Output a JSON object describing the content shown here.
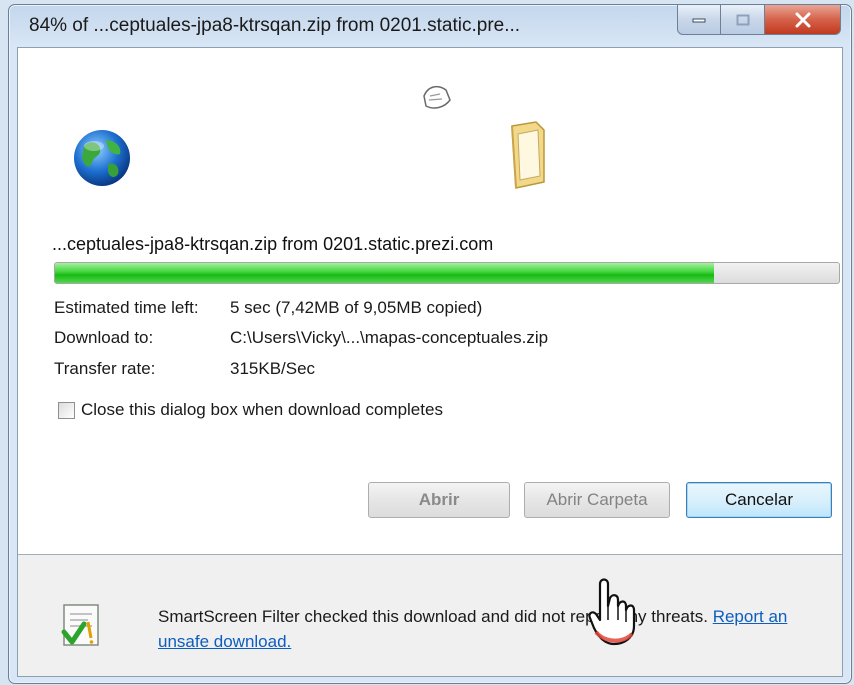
{
  "window": {
    "title": "84% of ...ceptuales-jpa8-ktrsqan.zip from 0201.static.pre...",
    "controls": [
      "minimize-icon",
      "maximize-icon",
      "close-icon"
    ]
  },
  "download": {
    "filename_label": "...ceptuales-jpa8-ktrsqan.zip from 0201.static.prezi.com",
    "progress_fraction": 0.84,
    "estimated_label": "Estimated time left:",
    "estimated_value": "5 sec (7,42MB of 9,05MB copied)",
    "download_to_label": "Download to:",
    "download_to_value": "C:\\Users\\Vicky\\...\\mapas-conceptuales.zip",
    "rate_label": "Transfer rate:",
    "rate_value": "315KB/Sec"
  },
  "checkbox": {
    "label": "Close this dialog box when download completes",
    "checked": false
  },
  "buttons": {
    "open": "Abrir",
    "open_folder": "Abrir Carpeta",
    "cancel": "Cancelar"
  },
  "smartscreen": {
    "text": "SmartScreen Filter checked this download and did not report any threats.",
    "link": "Report an unsafe download."
  },
  "icons": [
    "globe-icon",
    "folder-icon",
    "paper-icon",
    "shield-check-icon",
    "hand-cursor-icon"
  ]
}
